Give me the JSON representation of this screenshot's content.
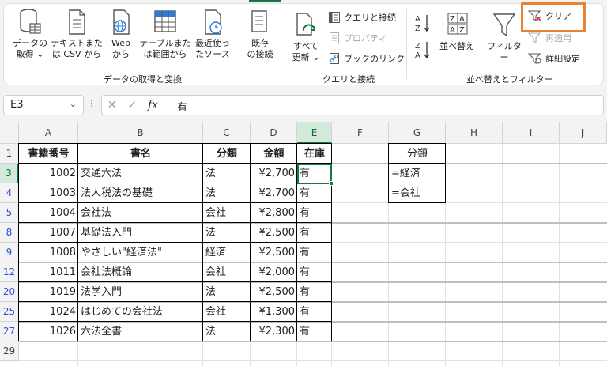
{
  "ribbon": {
    "get_data": {
      "label": "データの\n取得 ⌄"
    },
    "from_text": {
      "label": "テキストまた\nは CSV から"
    },
    "from_web": {
      "label": "Web\nから"
    },
    "from_table": {
      "label": "テーブルまた\nは範囲から"
    },
    "recent_sources": {
      "label": "最近使っ\nたソース"
    },
    "existing_conn": {
      "label": "既存\nの接続"
    },
    "group1_label": "データの取得と変換",
    "refresh_all": {
      "label": "すべて\n更新 ⌄"
    },
    "queries_conn": "クエリと接続",
    "properties": "プロパティ",
    "edit_links": "ブックのリンク",
    "group2_label": "クエリと接続",
    "sort_az": "A↓Z",
    "sort_za": "Z↓A",
    "sort": "並べ替え",
    "filter": "フィルター",
    "clear": "クリア",
    "reapply": "再適用",
    "advanced": "詳細設定",
    "group3_label": "並べ替えとフィルター"
  },
  "formula_bar": {
    "name_box": "E3",
    "name_chevron": "⌄",
    "dots": "⁝",
    "cancel": "✕",
    "enter": "✓",
    "fx": "fx",
    "value": "有"
  },
  "grid": {
    "columns": [
      "A",
      "B",
      "C",
      "D",
      "E",
      "F",
      "G",
      "H",
      "I",
      "J"
    ],
    "rows": [
      "1",
      "3",
      "4",
      "5",
      "8",
      "9",
      "12",
      "20",
      "25",
      "27",
      "29"
    ],
    "header_row": [
      "書籍番号",
      "書名",
      "分類",
      "金額",
      "在庫"
    ],
    "records": [
      [
        "1002",
        "交通六法",
        "法",
        "¥2,700",
        "有"
      ],
      [
        "1003",
        "法人税法の基礎",
        "法",
        "¥2,700",
        "有"
      ],
      [
        "1004",
        "会社法",
        "会社",
        "¥2,800",
        "有"
      ],
      [
        "1007",
        "基礎法入門",
        "法",
        "¥2,500",
        "有"
      ],
      [
        "1008",
        "やさしい\"経済法\"",
        "経済",
        "¥2,500",
        "有"
      ],
      [
        "1011",
        "会社法概論",
        "会社",
        "¥2,000",
        "有"
      ],
      [
        "1019",
        "法学入門",
        "法",
        "¥2,500",
        "有"
      ],
      [
        "1024",
        "はじめての会社法",
        "会社",
        "¥1,300",
        "有"
      ],
      [
        "1026",
        "六法全書",
        "法",
        "¥2,300",
        "有"
      ]
    ],
    "criteria": {
      "header": "分類",
      "values": [
        "=経済",
        "=会社"
      ]
    }
  },
  "colors": {
    "accent_green": "#107c41",
    "highlight_orange": "#e8822e",
    "filtered_row_blue": "#3050d8"
  }
}
